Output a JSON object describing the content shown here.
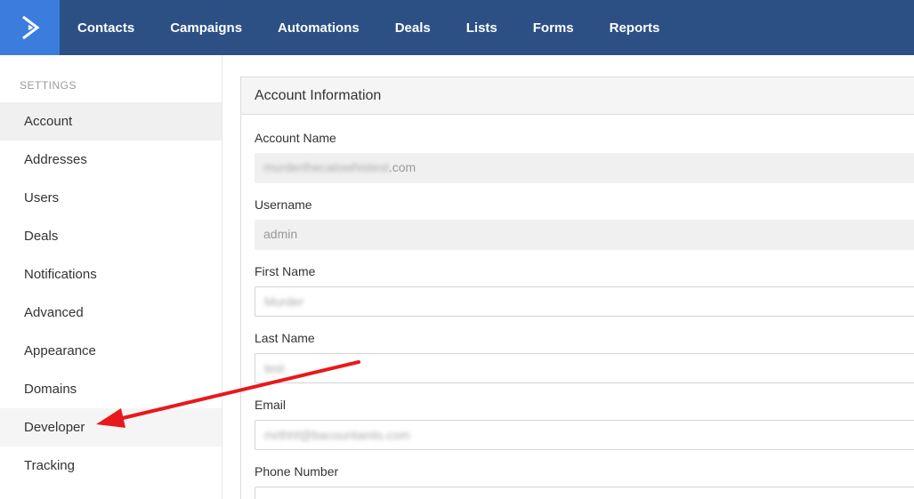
{
  "nav": {
    "items": [
      "Contacts",
      "Campaigns",
      "Automations",
      "Deals",
      "Lists",
      "Forms",
      "Reports"
    ]
  },
  "sidebar": {
    "heading": "SETTINGS",
    "items": [
      "Account",
      "Addresses",
      "Users",
      "Deals",
      "Notifications",
      "Advanced",
      "Appearance",
      "Domains",
      "Developer",
      "Tracking"
    ],
    "active": "Account",
    "highlighted": "Developer"
  },
  "panel": {
    "title": "Account Information",
    "fields": {
      "account_name": {
        "label": "Account Name",
        "value_blurred": "murderthecatowhistest",
        "value_suffix": ".com"
      },
      "username": {
        "label": "Username",
        "value": "admin"
      },
      "first_name": {
        "label": "First Name",
        "value_blurred": "Murder"
      },
      "last_name": {
        "label": "Last Name",
        "value_blurred": "test"
      },
      "email": {
        "label": "Email",
        "value_blurred": "mrthhf@bacountaints.com"
      },
      "phone": {
        "label": "Phone Number",
        "value": ""
      }
    }
  },
  "colors": {
    "topbar": "#2c4f84",
    "logo_bg": "#3b7ddd",
    "arrow": "#e8191b"
  }
}
